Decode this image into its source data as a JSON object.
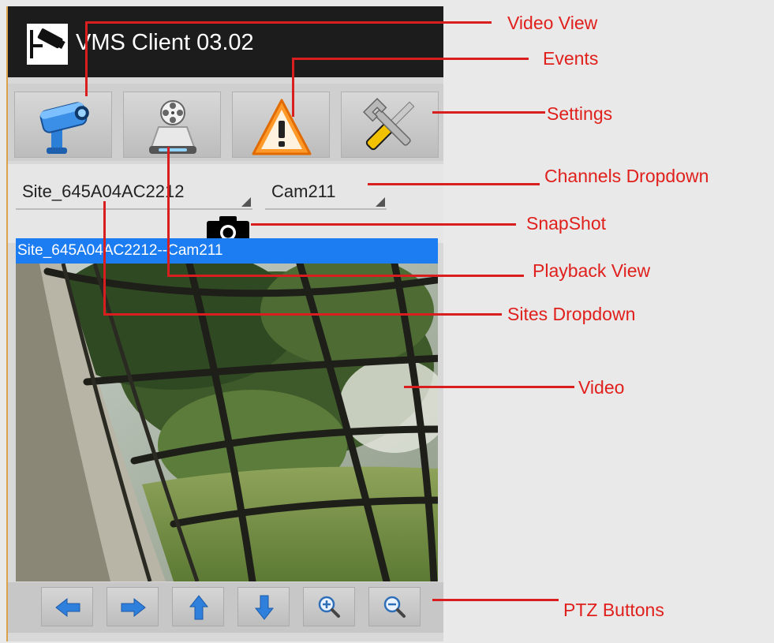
{
  "app": {
    "title": "VMS Client 03.02",
    "logo_icon": "cctv-camera-icon"
  },
  "toolbar": {
    "buttons": [
      {
        "icon": "security-camera-icon",
        "label": "Video View"
      },
      {
        "icon": "film-reel-drive-icon",
        "label": "Playback View"
      },
      {
        "icon": "warning-triangle-icon",
        "label": "Events"
      },
      {
        "icon": "wrench-screwdriver-icon",
        "label": "Settings"
      }
    ]
  },
  "dropdowns": {
    "site": {
      "value": "Site_645A04AC2212"
    },
    "channel": {
      "value": "Cam211"
    }
  },
  "snapshot": {
    "icon": "camera-icon"
  },
  "video": {
    "header": "Site_645A04AC2212--Cam211"
  },
  "ptz": {
    "buttons": [
      {
        "icon": "arrow-left-icon"
      },
      {
        "icon": "arrow-right-icon"
      },
      {
        "icon": "arrow-up-icon"
      },
      {
        "icon": "arrow-down-icon"
      },
      {
        "icon": "zoom-in-icon"
      },
      {
        "icon": "zoom-out-icon"
      }
    ]
  },
  "annotations": {
    "video_view": "Video View",
    "events": "Events",
    "settings": "Settings",
    "channels_dropdown": "Channels Dropdown",
    "snapshot": "SnapShot",
    "playback_view": "Playback View",
    "sites_dropdown": "Sites Dropdown",
    "video": "Video",
    "ptz_buttons": "PTZ Buttons"
  },
  "colors": {
    "annotation": "#e0201c",
    "header_blue": "#1c7cf2",
    "titlebar": "#1c1c1c"
  }
}
